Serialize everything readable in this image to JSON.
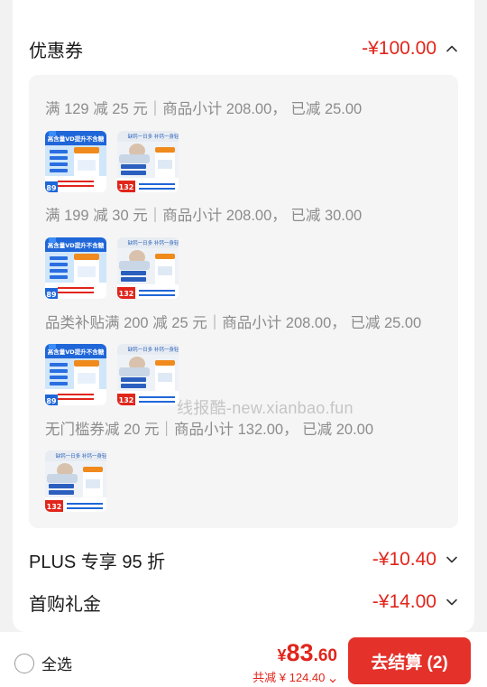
{
  "coupon": {
    "label": "优惠券",
    "amount": "-¥100.00",
    "icon": "chevron-up-icon",
    "rules": [
      {
        "text": "满 129 减 25 元｜商品小计 208.00， 已减 25.00",
        "thumbs": [
          "supplement-product-a",
          "supplement-product-b"
        ]
      },
      {
        "text": "满 199 减 30 元｜商品小计 208.00， 已减 30.00",
        "thumbs": [
          "supplement-product-a",
          "supplement-product-b"
        ]
      },
      {
        "text": "品类补贴满 200 减 25 元｜商品小计 208.00， 已减 25.00",
        "thumbs": [
          "supplement-product-a",
          "supplement-product-b"
        ]
      },
      {
        "text": "无门槛券减 20 元｜商品小计 132.00， 已减 20.00",
        "thumbs": [
          "supplement-product-b"
        ]
      }
    ]
  },
  "product_thumbs": {
    "a": {
      "banner": "高含量VD提升不含糖",
      "badge": "89"
    },
    "b": {
      "banner": "缺钙一日多 补钙一身轻",
      "badge": "132"
    }
  },
  "plus": {
    "label": "PLUS 专享 95 折",
    "amount": "-¥10.40",
    "icon": "chevron-down-icon"
  },
  "first_gift": {
    "label": "首购礼金",
    "amount": "-¥14.00",
    "icon": "chevron-down-icon"
  },
  "watermark": "线报酷-new.xianbao.fun",
  "footer": {
    "select_all": "全选",
    "price_currency": "¥",
    "price_int": "83",
    "price_dec": ".60",
    "total_saved": "共减 ¥ 124.40",
    "checkout_label": "去结算 (2)"
  },
  "colors": {
    "accent_red": "#e1251b",
    "checkout_bg": "#e4312a",
    "panel_bg": "#f5f5f5"
  }
}
